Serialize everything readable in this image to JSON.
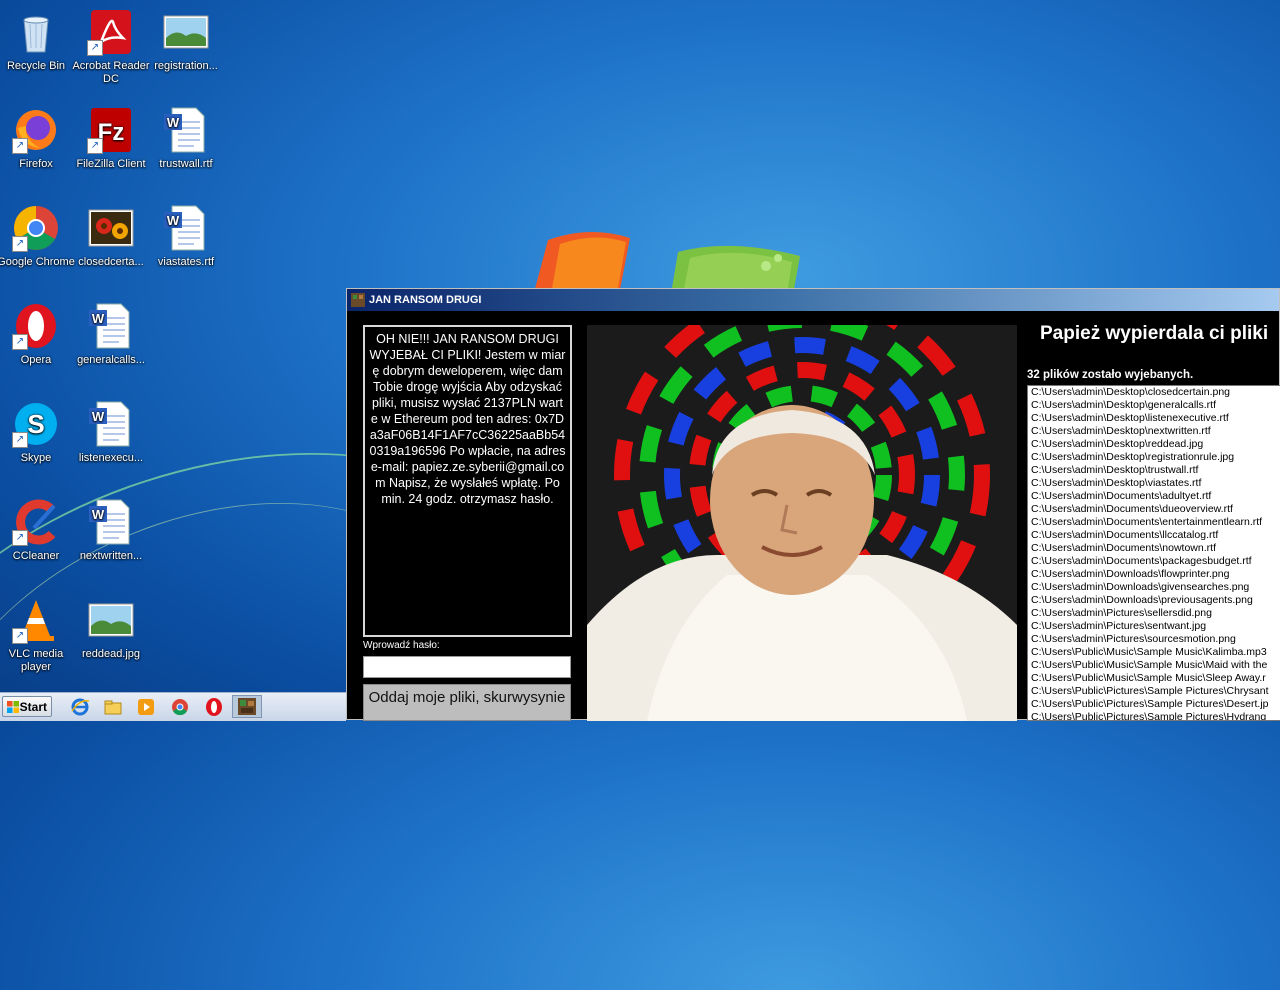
{
  "desktop": {
    "icons": [
      {
        "label": "Recycle Bin",
        "icon": "recycle-bin-icon"
      },
      {
        "label": "Acrobat Reader DC",
        "icon": "acrobat-icon"
      },
      {
        "label": "registration...",
        "icon": "image-file-icon"
      },
      {
        "label": "Firefox",
        "icon": "firefox-icon"
      },
      {
        "label": "FileZilla Client",
        "icon": "filezilla-icon"
      },
      {
        "label": "trustwall.rtf",
        "icon": "word-doc-icon"
      },
      {
        "label": "Google Chrome",
        "icon": "chrome-icon"
      },
      {
        "label": "closedcerta...",
        "icon": "flower-image-icon"
      },
      {
        "label": "viastates.rtf",
        "icon": "word-doc-icon"
      },
      {
        "label": "Opera",
        "icon": "opera-icon"
      },
      {
        "label": "generalcalls...",
        "icon": "word-doc-icon"
      },
      {
        "label": "Skype",
        "icon": "skype-icon"
      },
      {
        "label": "listenexecu...",
        "icon": "word-doc-icon"
      },
      {
        "label": "CCleaner",
        "icon": "ccleaner-icon"
      },
      {
        "label": "nextwritten...",
        "icon": "word-doc-icon"
      },
      {
        "label": "VLC media player",
        "icon": "vlc-icon"
      },
      {
        "label": "reddead.jpg",
        "icon": "image-file-icon"
      }
    ]
  },
  "taskbar": {
    "start_label": "Start",
    "pinned": [
      "ie-icon",
      "explorer-icon",
      "media-player-icon",
      "chrome-icon",
      "opera-icon",
      "ransom-app-icon"
    ]
  },
  "ransom_window": {
    "title": "JAN RANSOM DRUGI",
    "note": "OH NIE!!! JAN RANSOM DRUGI WYJEBAŁ CI PLIKI! Jestem w miarę dobrym deweloperem, więc dam Tobie drogę wyjścia Aby odzyskać pliki, musisz wysłać 2137PLN warte w Ethereum pod ten adres: 0x7Da3aF06B14F1AF7cC36225aaBb540319a196596 Po wpłacie, na adres e-mail: papiez.ze.syberii@gmail.com Napisz, że wysłałeś wpłatę. Po min. 24 godz. otrzymasz hasło.",
    "password_label": "Wprowadź hasło:",
    "password_value": "",
    "button_label": "Oddaj moje pliki, skurwysynie",
    "heading": "Papież wypierdala ci pliki",
    "count_text": "32 plików zostało wyjebanych.",
    "files": [
      "C:\\Users\\admin\\Desktop\\closedcertain.png",
      "C:\\Users\\admin\\Desktop\\generalcalls.rtf",
      "C:\\Users\\admin\\Desktop\\listenexecutive.rtf",
      "C:\\Users\\admin\\Desktop\\nextwritten.rtf",
      "C:\\Users\\admin\\Desktop\\reddead.jpg",
      "C:\\Users\\admin\\Desktop\\registrationrule.jpg",
      "C:\\Users\\admin\\Desktop\\trustwall.rtf",
      "C:\\Users\\admin\\Desktop\\viastates.rtf",
      "C:\\Users\\admin\\Documents\\adultyet.rtf",
      "C:\\Users\\admin\\Documents\\dueoverview.rtf",
      "C:\\Users\\admin\\Documents\\entertainmentlearn.rtf",
      "C:\\Users\\admin\\Documents\\llccatalog.rtf",
      "C:\\Users\\admin\\Documents\\nowtown.rtf",
      "C:\\Users\\admin\\Documents\\packagesbudget.rtf",
      "C:\\Users\\admin\\Downloads\\flowprinter.png",
      "C:\\Users\\admin\\Downloads\\givensearches.png",
      "C:\\Users\\admin\\Downloads\\previousagents.png",
      "C:\\Users\\admin\\Pictures\\sellersdid.png",
      "C:\\Users\\admin\\Pictures\\sentwant.jpg",
      "C:\\Users\\admin\\Pictures\\sourcesmotion.png",
      "C:\\Users\\Public\\Music\\Sample Music\\Kalimba.mp3",
      "C:\\Users\\Public\\Music\\Sample Music\\Maid with the",
      "C:\\Users\\Public\\Music\\Sample Music\\Sleep Away.r",
      "C:\\Users\\Public\\Pictures\\Sample Pictures\\Chrysant",
      "C:\\Users\\Public\\Pictures\\Sample Pictures\\Desert.jp",
      "C:\\Users\\Public\\Pictures\\Sample Pictures\\Hydrang"
    ]
  }
}
